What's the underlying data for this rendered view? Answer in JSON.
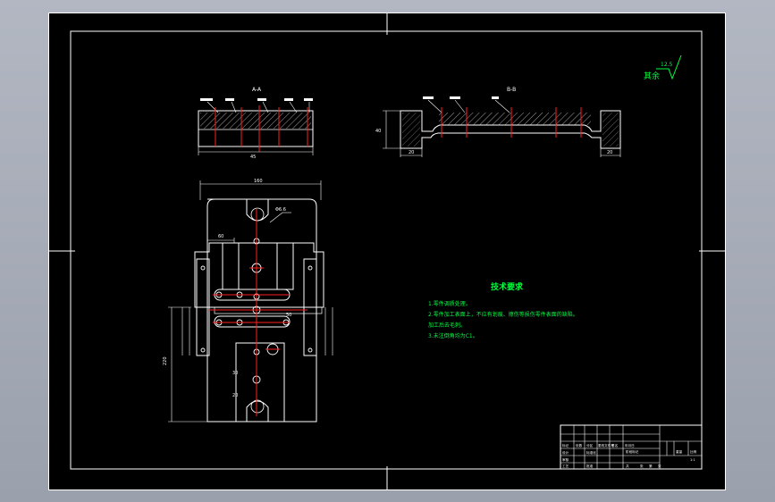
{
  "drawing": {
    "view_labels": {
      "section_a": "A-A",
      "section_b": "B-B"
    },
    "roughness": {
      "prefix": "其余",
      "value": "12.5"
    },
    "notes": {
      "title": "技术要求",
      "items": [
        "1.零件调质处理。",
        "2.零件加工表面上，不应有划痕、擦伤等损伤零件表面的缺陷。",
        "加工后去毛刺。",
        "3.未注倒角均为C1。"
      ]
    },
    "dim_labels": {
      "a_bottom": "45",
      "b_height": "40",
      "b_left": "20",
      "b_right": "20",
      "top_width": "160",
      "left_height": "220",
      "left_offset": "60",
      "hole_a": "Φ6.6",
      "center_a": "50",
      "center_b": "30",
      "center_c": "20"
    },
    "title_block": {
      "row1": [
        "标记",
        "处数",
        "分区",
        "更改文件号",
        "签名",
        "年月日"
      ],
      "row2": [
        "设计",
        "",
        "标准化",
        ""
      ],
      "row3": [
        "审核",
        ""
      ],
      "row4": [
        "工艺",
        "",
        "批准",
        ""
      ],
      "mid": [
        "阶段标记",
        "重量",
        "比例"
      ],
      "mid2": [
        "共",
        "张",
        "第",
        "张"
      ],
      "scale": "1:1"
    }
  }
}
